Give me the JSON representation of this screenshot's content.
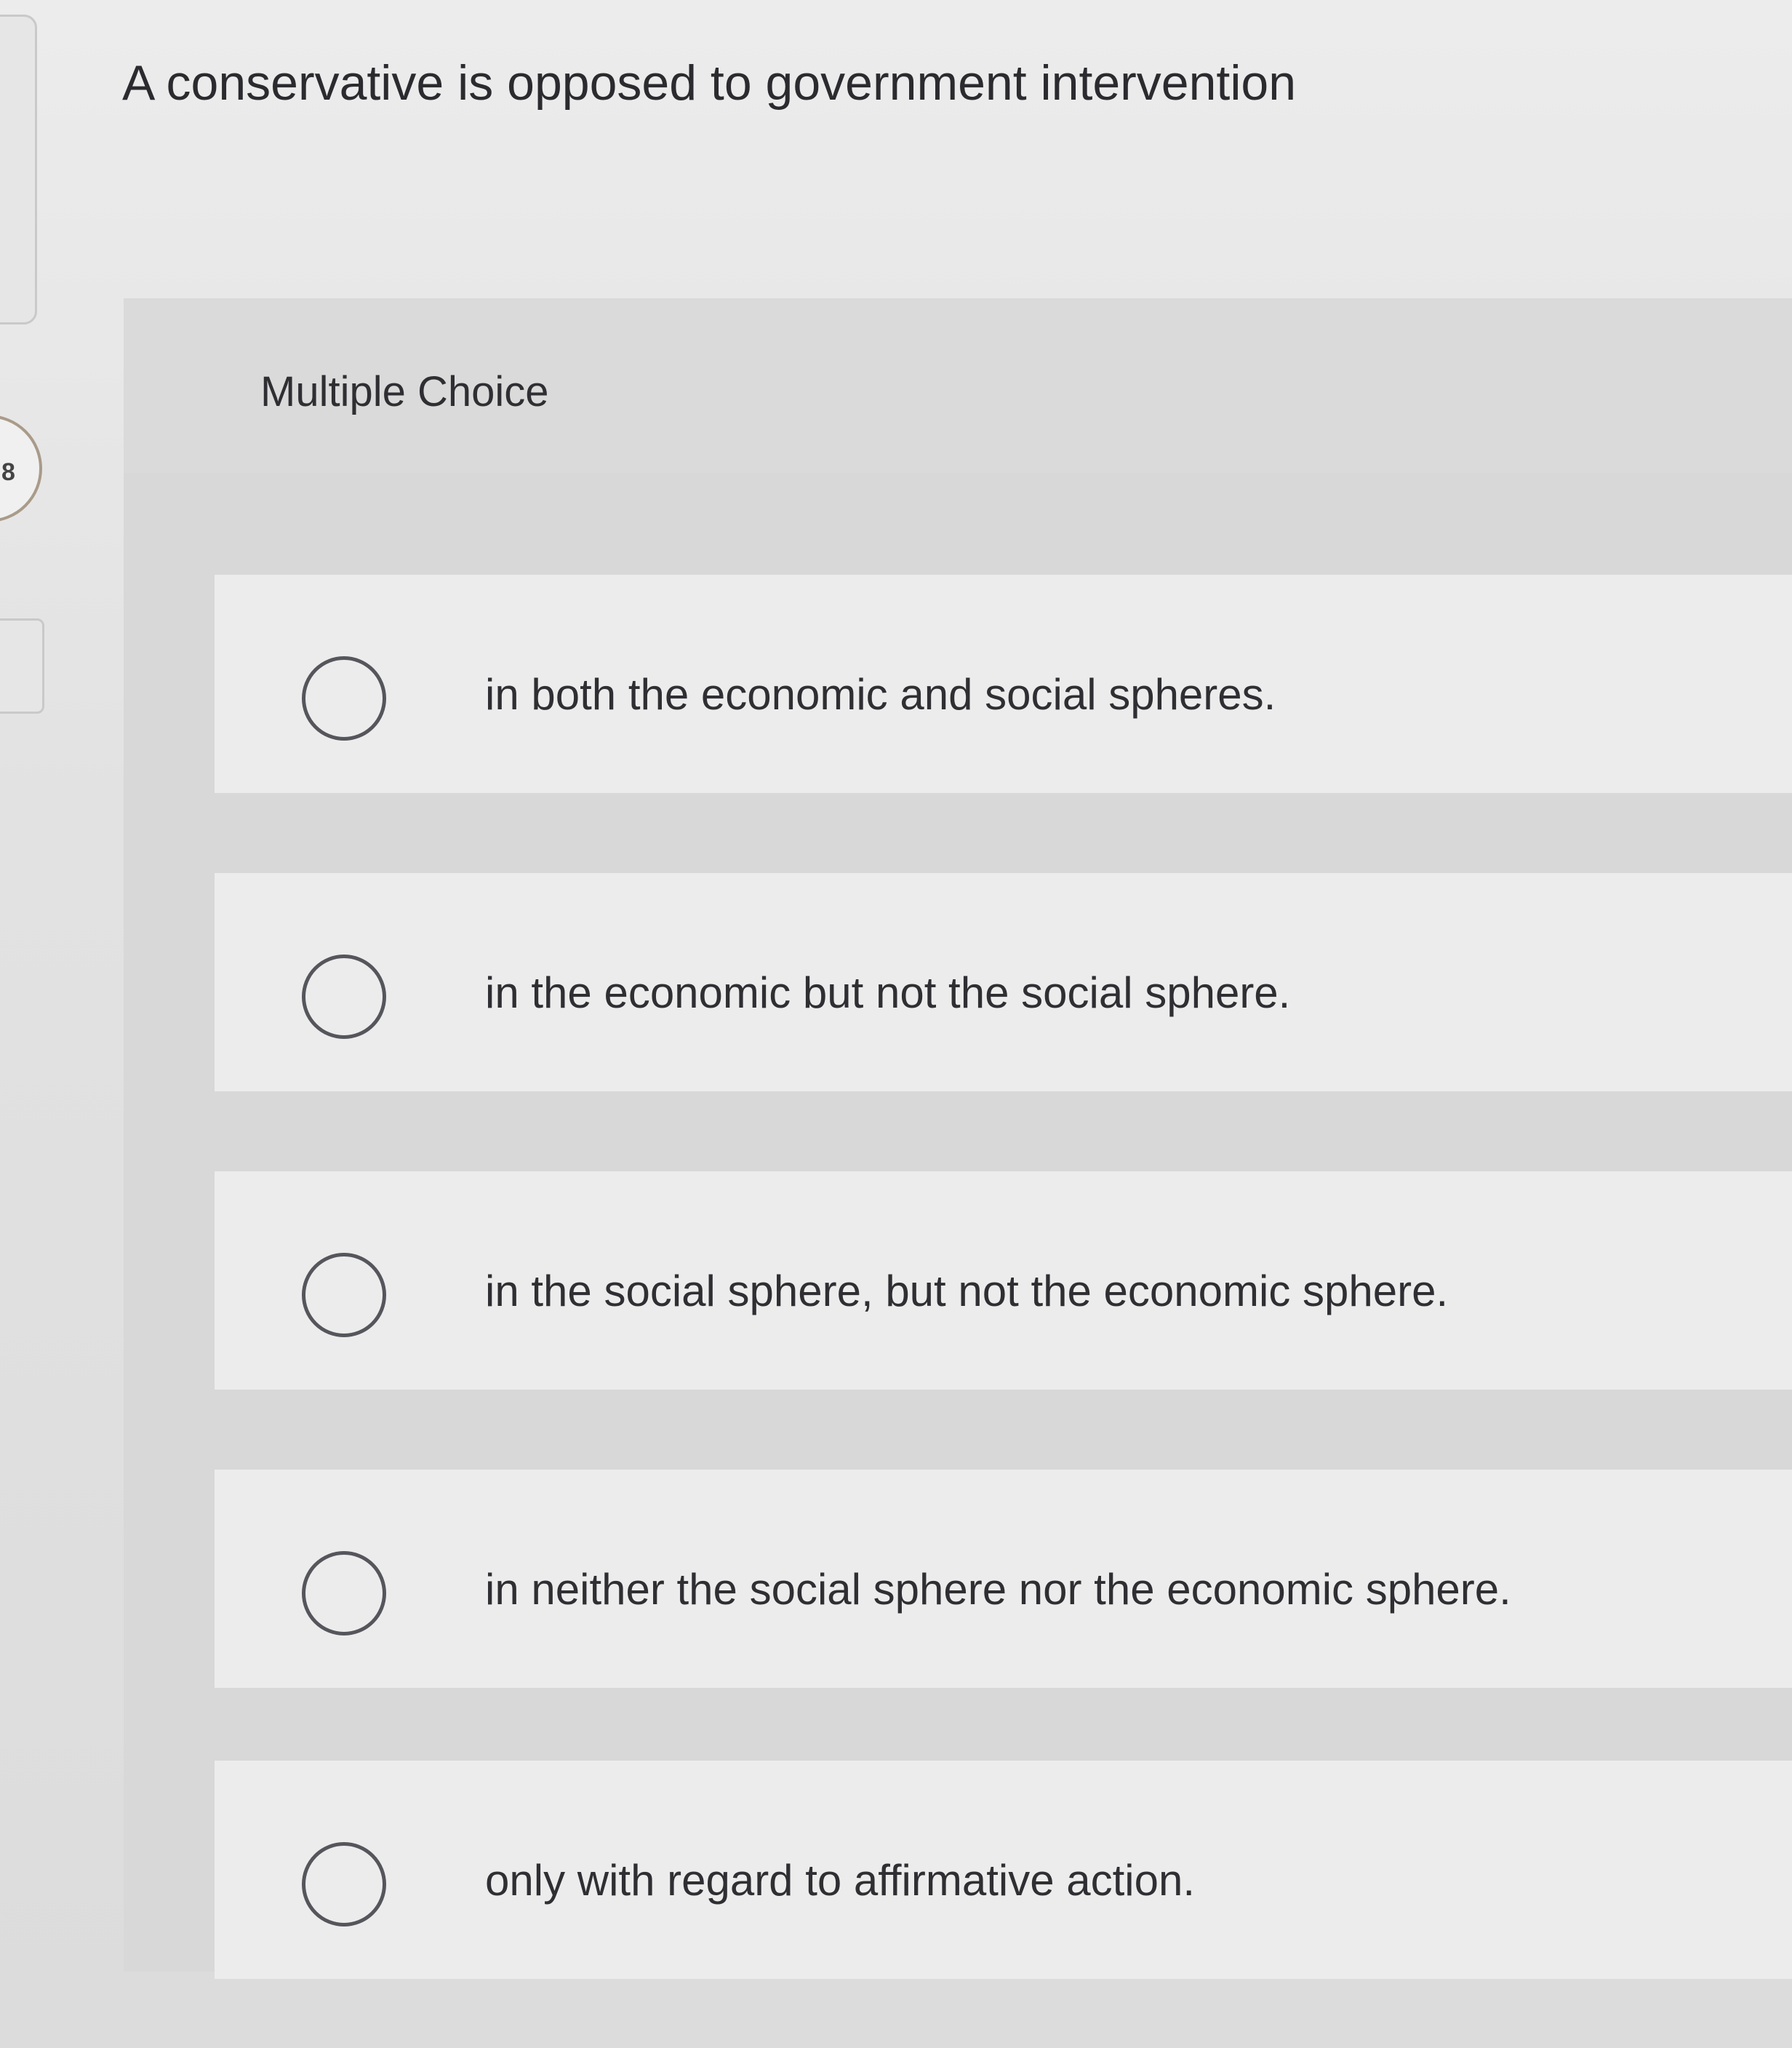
{
  "nav": {
    "question_number": "8"
  },
  "question": {
    "prompt": "A conservative is opposed to government intervention",
    "type_label": "Multiple Choice",
    "choices": [
      {
        "label": "in both the economic and social spheres."
      },
      {
        "label": "in the economic but not the social sphere."
      },
      {
        "label": "in the social sphere, but not the economic sphere."
      },
      {
        "label": "in neither the social sphere nor the economic sphere."
      },
      {
        "label": "only with regard to affirmative action."
      }
    ]
  }
}
